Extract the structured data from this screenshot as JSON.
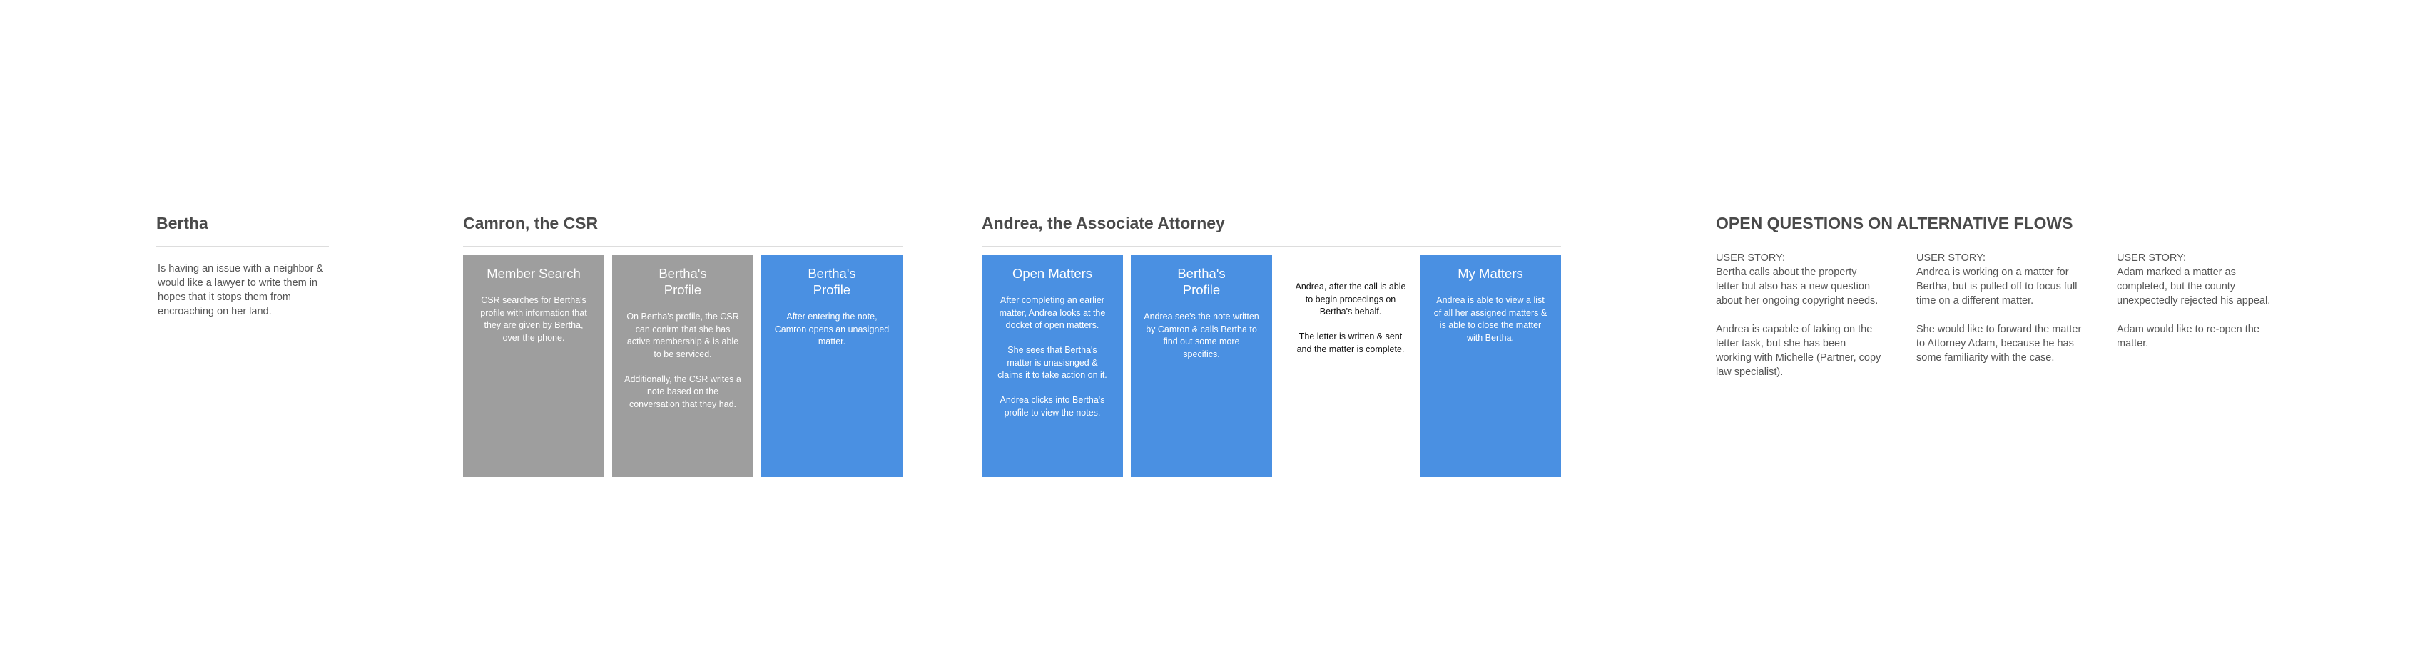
{
  "bertha": {
    "title": "Bertha",
    "description": "Is having an issue with a neighbor &\nwould like a lawyer to write them in\nhopes that it stops them from\nencroaching on her land."
  },
  "csr": {
    "title": "Camron, the CSR",
    "cards": [
      {
        "title": "Member Search",
        "body": "CSR searches for Bertha's\nprofile with information that\nthey are given by Bertha,\nover the phone.",
        "color": "#9e9e9e"
      },
      {
        "title": "Bertha's\nProfile",
        "body": "On Bertha's profile, the CSR\ncan conirm that she has\nactive membership & is able\nto be serviced.\n\nAdditionally, the CSR writes a\nnote based on the\nconversation that they had.",
        "color": "#9e9e9e"
      },
      {
        "title": "Bertha's\nProfile",
        "body": "After entering the note,\nCamron opens an unasigned\nmatter.",
        "color": "#4a90e2"
      }
    ]
  },
  "attorney": {
    "title": "Andrea, the Associate Attorney",
    "cards": [
      {
        "title": "Open Matters",
        "body": "After completing an earlier\nmatter, Andrea looks at the\ndocket of open matters.\n\nShe sees that Bertha's\nmatter is unasisnged &\nclaims it to take action on it.\n\nAndrea clicks into Bertha's\nprofile to view the notes.",
        "color": "#4a90e2"
      },
      {
        "title": "Bertha's\nProfile",
        "body": "Andrea see's the note written\nby Camron & calls Bertha to\nfind out some more\nspecifics.",
        "color": "#4a90e2"
      },
      {
        "title": "",
        "body": "Andrea, after the call is able\nto begin procedings on\nBertha's behalf.\n\nThe letter is written & sent\nand the matter is complete.",
        "color": "#ffffff"
      },
      {
        "title": "My Matters",
        "body": "Andrea is able to view a list\nof all her assigned matters &\nis able to close the matter\nwith Bertha.",
        "color": "#4a90e2"
      }
    ]
  },
  "open_questions": {
    "title": "OPEN QUESTIONS ON ALTERNATIVE FLOWS",
    "stories": [
      {
        "label": "USER STORY:",
        "text": "Bertha calls about the property\nletter but also has a new question\nabout her ongoing copyright needs.\n\nAndrea is capable of taking on the\nletter task, but she has been\nworking with Michelle (Partner, copy\nlaw specialist)."
      },
      {
        "label": "USER STORY:",
        "text": "Andrea is working on a matter for\nBertha, but is pulled off to focus full\ntime on a different matter.\n\nShe would like to forward the matter\nto Attorney Adam, because he has\nsome familiarity with the case."
      },
      {
        "label": "USER STORY:",
        "text": "Adam marked a matter as\ncompleted, but the county\nunexpectedly rejected his appeal.\n\nAdam would like to re-open the\nmatter."
      }
    ]
  }
}
